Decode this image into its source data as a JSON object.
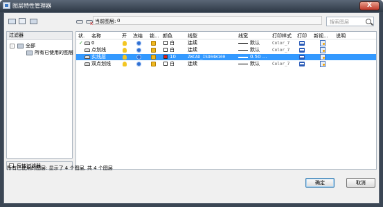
{
  "window": {
    "title": "图层特性管理器",
    "close_label": "X"
  },
  "toolbar": {
    "icons": [
      "new-property-filter-icon",
      "new-group-filter-icon",
      "layer-states-manager-icon",
      "new-layer-icon",
      "delete-layer-icon",
      "set-current-icon"
    ],
    "current_layer_label": "当前图层:",
    "current_layer_value": "0",
    "search_placeholder": "搜索图层"
  },
  "filters": {
    "header": "过滤器",
    "tree": [
      {
        "label": "全部",
        "expander": "-"
      },
      {
        "label": "所有已使用的图层",
        "expander": ""
      }
    ],
    "invert_label": "反转过滤器"
  },
  "layers": {
    "columns": [
      "状.",
      "名称",
      "开",
      "冻结",
      "锁...",
      "颜色",
      "线型",
      "线宽",
      "打印样式",
      "打印",
      "新视...",
      "说明"
    ],
    "rows": [
      {
        "status": "✓",
        "name": "0",
        "color_name": "白",
        "color_hex": "#ffffff",
        "linetype": "连续",
        "lineweight": "默认",
        "plot_style": "Color_7",
        "selected": false
      },
      {
        "status": "",
        "name": "点划线",
        "color_name": "白",
        "color_hex": "#ffffff",
        "linetype": "连续",
        "lineweight": "默认",
        "plot_style": "Color_7",
        "selected": false
      },
      {
        "status": "",
        "name": "实线层",
        "color_name": "10",
        "color_hex": "#e02020",
        "linetype": "ZWCAD_ISO04W100",
        "lineweight": "0.50 ...",
        "plot_style": "",
        "selected": true
      },
      {
        "status": "",
        "name": "双点划线",
        "color_name": "白",
        "color_hex": "#ffffff",
        "linetype": "连续",
        "lineweight": "默认",
        "plot_style": "Color_7",
        "selected": false
      }
    ]
  },
  "statusbar": {
    "text": "所有已使用的图层: 显示了 4 个图层, 共 4 个图层"
  },
  "buttons": {
    "ok": "确定",
    "cancel": "取消"
  }
}
